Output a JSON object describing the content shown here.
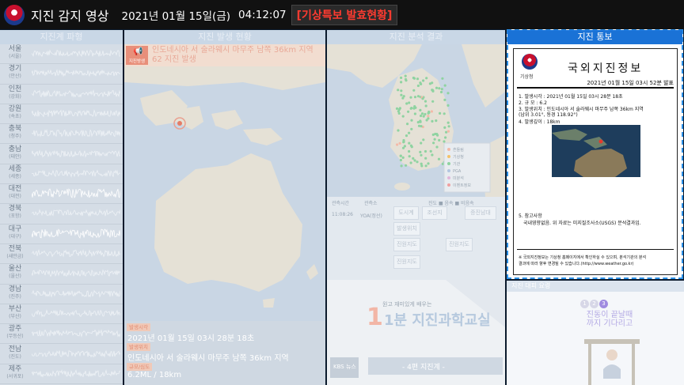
{
  "header": {
    "title": "지진 감지 영상",
    "date": "2021년 01월 15일(금)",
    "time": "04:12:07",
    "alert": "[기상특보 발효현황]"
  },
  "seismograph": {
    "title": "지진계 파형",
    "stations": [
      {
        "name": "서울",
        "sub": "(서울)"
      },
      {
        "name": "경기",
        "sub": "(안산)"
      },
      {
        "name": "인천",
        "sub": "(강화)"
      },
      {
        "name": "강원",
        "sub": "(속초)"
      },
      {
        "name": "충북",
        "sub": "(청주)"
      },
      {
        "name": "충남",
        "sub": "(태안)"
      },
      {
        "name": "세종",
        "sub": "(세종)"
      },
      {
        "name": "대전",
        "sub": "(대전)"
      },
      {
        "name": "경북",
        "sub": "(포항)"
      },
      {
        "name": "대구",
        "sub": "(대구)"
      },
      {
        "name": "전북",
        "sub": "(새만금)"
      },
      {
        "name": "울산",
        "sub": "(울산)"
      },
      {
        "name": "경남",
        "sub": "(진주)"
      },
      {
        "name": "부산",
        "sub": "(부산)"
      },
      {
        "name": "광주",
        "sub": "(무등산)"
      },
      {
        "name": "전남",
        "sub": "(진도)"
      },
      {
        "name": "제주",
        "sub": "(서귀포)"
      }
    ]
  },
  "eq_status": {
    "title": "지진 발생 현황",
    "icon_label": "지진방생",
    "banner_line1": "인도네시아 서 술라웨시 마무주 남쪽 36km 지역",
    "banner_line2": "62 지진 발생",
    "time_tag": "발생시각",
    "time_value": "2021년 01월 15일 03시 28분 18초",
    "location_tag": "발생위치",
    "location_value": "인도네시아 서 술라웨시 마무주 남쪽 36km 지역",
    "scale_tag": "규모/심도",
    "scale_value": "6.2ML / 18km"
  },
  "analysis": {
    "title": "지진 분석 결과",
    "legend": [
      "흔들림",
      "기상청",
      "기관",
      "PGA",
      "미분석",
      "이벤트정보"
    ],
    "table_heads": [
      "관측시간",
      "관측소",
      "진앙/발진지점",
      "진도 ■ 음속 ■ 비음속"
    ],
    "row_time": "11:08:26",
    "row_station": "YOA(정선)",
    "cells": [
      "도시계",
      "조선지",
      "증진남대",
      "발생위치",
      "진원지도",
      "진원지도",
      "진원지도"
    ],
    "video_title": "1분 지진과학교실",
    "video_sub": "원고 재미있게 배우는",
    "video_episode": "- 4편 지진계 -",
    "video_brand": "KBS 뉴스"
  },
  "notice": {
    "title": "지진 통보",
    "org": "기상청",
    "doc_title": "국외지진정보",
    "doc_date": "2021년 01월 15일 03시 52분 발표",
    "lines": [
      "1. 발생시각 :  2021년 01월 15일 03시 28분 18초",
      "2. 규       모 :  6.2",
      "3. 발생위치 :  인도네시아 서 술라웨시 마무주 남쪽 36km 지역",
      "                       (남위 3.01°, 동경 118.92°)",
      "4. 발생깊이 :  18km"
    ],
    "ref_head": "5. 참고사항",
    "ref_body": "국내영향없음. 위 자료는 미지질조사소(USGS) 분석결과임.",
    "foot1": "※ 국외지진정보는 기상청 홈페이지에서 확인하실 수 있으며, 분석기관의 분석",
    "foot2": "   결과에 따라 향후 변경될 수 있습니다.(http://www.weather.go.kr)"
  },
  "guide": {
    "title": "지진 대피 요령",
    "steps": [
      "1",
      "2",
      "3"
    ],
    "text1": "진동이 끝날때",
    "text2": "까지 기다리고"
  }
}
